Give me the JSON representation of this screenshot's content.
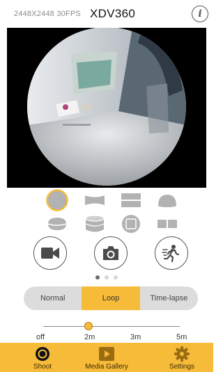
{
  "header": {
    "resolution": "2448X2448 30FPS",
    "model": "XDV360",
    "info_icon": "info-icon",
    "info_glyph": "i"
  },
  "preview": {
    "kind": "360-fisheye-live-view"
  },
  "view_modes": {
    "selected": "sphere",
    "items": [
      "sphere-view-icon",
      "panorama-curved-icon",
      "split-dual-icon",
      "dome-icon",
      "bowl-icon",
      "cylinder-icon",
      "planet-square-icon",
      "dual-rect-icon"
    ]
  },
  "actions": {
    "video_icon": "video-camera-icon",
    "photo_icon": "camera-icon",
    "motion_icon": "runner-motion-icon"
  },
  "pager": {
    "count": 3,
    "active": 0
  },
  "capture_modes": {
    "items": [
      "Normal",
      "Loop",
      "Time-lapse"
    ],
    "selected": "Loop"
  },
  "loop_slider": {
    "labels": [
      "off",
      "2m",
      "3m",
      "5m"
    ],
    "value": "2m"
  },
  "nav": {
    "shoot": "Shoot",
    "gallery": "Media Gallery",
    "settings": "Settings",
    "active": "Shoot"
  },
  "colors": {
    "accent": "#f7bb3a",
    "icon_gray": "#b2b2b2"
  }
}
